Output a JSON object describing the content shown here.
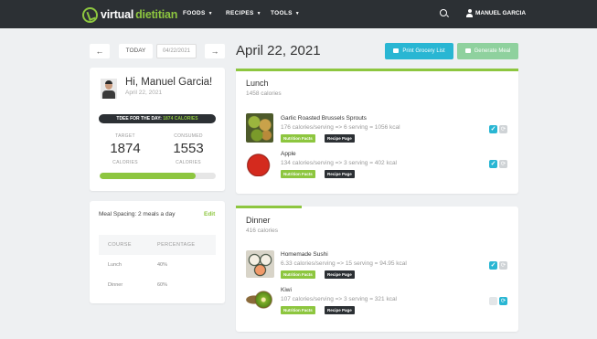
{
  "navbar": {
    "logo_part1": "virtual",
    "logo_part2": "dietitian",
    "menu": [
      "FOODS",
      "RECIPES",
      "TOOLS"
    ],
    "user": "MANUEL GARCIA"
  },
  "date_nav": {
    "prev": "←",
    "today": "TODAY",
    "date_value": "04/22/2021",
    "next": "→"
  },
  "page_date": "April 22, 2021",
  "actions": {
    "print": "Print Grocery List",
    "generate": "Generate Meal"
  },
  "summary": {
    "greeting": "Hi, Manuel Garcia!",
    "date": "April 22, 2021",
    "tdee_label": "TDEE FOR THE DAY:",
    "tdee_value": "1874 CALORIES",
    "target_label": "TARGET",
    "target_value": "1874",
    "target_unit": "CALORIES",
    "consumed_label": "CONSUMED",
    "consumed_value": "1553",
    "consumed_unit": "CALORIES",
    "progress": 0.83
  },
  "meal_spacing": {
    "title": "Meal Spacing: 2 meals a day",
    "edit": "Edit",
    "headers": [
      "COURSE",
      "PERCENTAGE"
    ],
    "rows": [
      {
        "course": "Lunch",
        "percentage": "40%"
      },
      {
        "course": "Dinner",
        "percentage": "60%"
      }
    ]
  },
  "meals": [
    {
      "title": "Lunch",
      "calories": "1458 calories",
      "foods": [
        {
          "name": "Garlic Roasted Brussels Sprouts",
          "desc": "176 calories/serving => 6 serving = 1056 kcal",
          "nutrition": "Nutrition Facts",
          "recipe": "Recipe Page",
          "checked": true
        },
        {
          "name": "Apple",
          "desc": "134 calories/serving => 3 serving = 402 kcal",
          "nutrition": "Nutrition Facts",
          "recipe": "Recipe Page",
          "checked": true
        }
      ]
    },
    {
      "title": "Dinner",
      "calories": "416 calories",
      "foods": [
        {
          "name": "Homemade Sushi",
          "desc": "6.33 calories/serving => 15 serving = 94.95 kcal",
          "nutrition": "Nutrition Facts",
          "recipe": "Recipe Page",
          "checked": true
        },
        {
          "name": "Kiwi",
          "desc": "107 calories/serving => 3 serving = 321 kcal",
          "nutrition": "Nutrition Facts",
          "recipe": "Recipe Page",
          "checked": false
        }
      ]
    }
  ],
  "colors": {
    "navbar": "#2c3034",
    "accent_green": "#8dc63f",
    "accent_blue": "#29b6d3",
    "light_green": "#8fd19e"
  }
}
